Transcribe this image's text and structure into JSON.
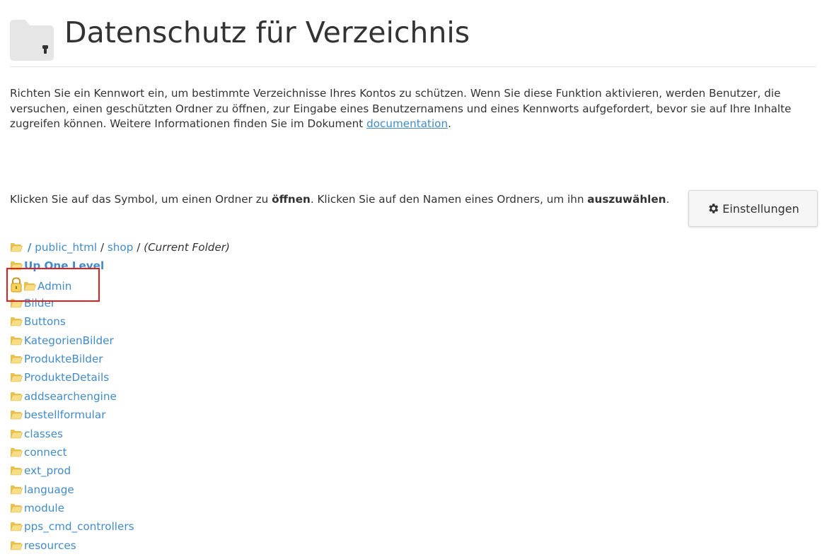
{
  "header": {
    "title": "Datenschutz für Verzeichnis",
    "icon": "folder-lock-icon"
  },
  "intro": {
    "text_before_link": "Richten Sie ein Kennwort ein, um bestimmte Verzeichnisse Ihres Kontos zu schützen. Wenn Sie diese Funktion aktivieren, werden Benutzer, die versuchen, einen geschützten Ordner zu öffnen, zur Eingabe eines Benutzernamens und eines Kennworts aufgefordert, bevor sie auf Ihre Inhalte zugreifen können. Weitere Informationen finden Sie im Dokument ",
    "link_text": "documentation",
    "text_after_link": "."
  },
  "instruction": {
    "part1": "Klicken Sie auf das Symbol, um einen Ordner zu ",
    "bold1": "öffnen",
    "part2": ". Klicken Sie auf den Namen eines Ordners, um ihn ",
    "bold2": "auszuwählen",
    "part3": "."
  },
  "settings_button": {
    "label": "Einstellungen",
    "icon": "gear-icon"
  },
  "breadcrumb": {
    "root": "/",
    "sep": "/",
    "items": [
      "public_html",
      "shop"
    ],
    "current": "(Current Folder)"
  },
  "folders": {
    "up": "Up One Level",
    "items": [
      {
        "name": "Admin",
        "locked": true
      },
      {
        "name": "Bilder",
        "locked": false
      },
      {
        "name": "Buttons",
        "locked": false
      },
      {
        "name": "KategorienBilder",
        "locked": false
      },
      {
        "name": "ProdukteBilder",
        "locked": false
      },
      {
        "name": "ProdukteDetails",
        "locked": false
      },
      {
        "name": "addsearchengine",
        "locked": false
      },
      {
        "name": "bestellformular",
        "locked": false
      },
      {
        "name": "classes",
        "locked": false
      },
      {
        "name": "connect",
        "locked": false
      },
      {
        "name": "ext_prod",
        "locked": false
      },
      {
        "name": "language",
        "locked": false
      },
      {
        "name": "module",
        "locked": false
      },
      {
        "name": "pps_cmd_controllers",
        "locked": false
      },
      {
        "name": "resources",
        "locked": false
      }
    ]
  },
  "colors": {
    "link": "#428bca",
    "highlight": "#e02020",
    "folder": "#f2d675"
  }
}
